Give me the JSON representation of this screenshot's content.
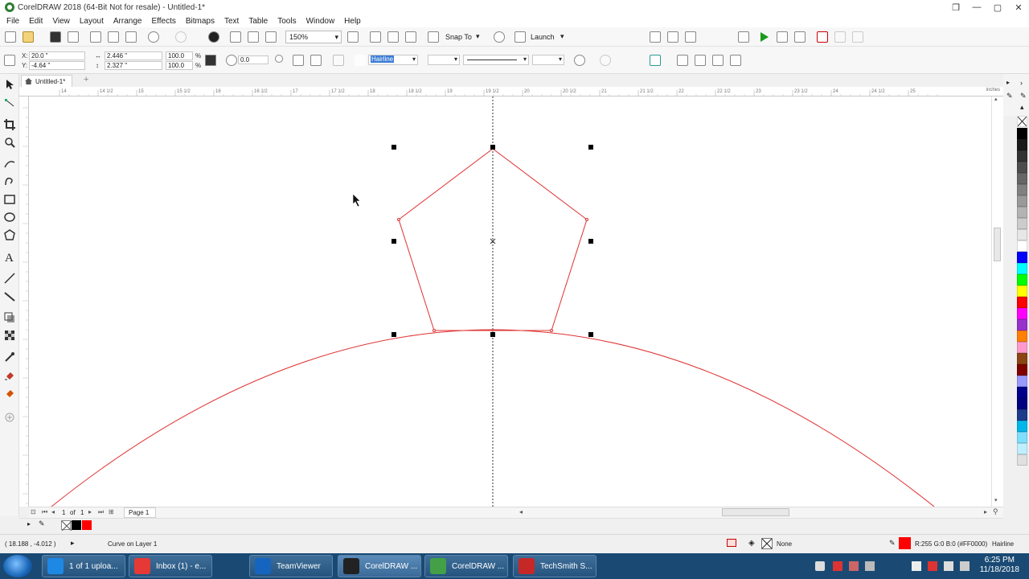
{
  "window": {
    "title": "CorelDRAW 2018 (64-Bit Not for resale) - Untitled-1*",
    "buttons": [
      "restore-down",
      "minimize",
      "maximize",
      "close"
    ]
  },
  "menu": [
    "File",
    "Edit",
    "View",
    "Layout",
    "Arrange",
    "Effects",
    "Bitmaps",
    "Text",
    "Table",
    "Tools",
    "Window",
    "Help"
  ],
  "toolbar": {
    "zoom_level": "150%",
    "snap_label": "Snap To",
    "launch_label": "Launch"
  },
  "property_bar": {
    "x": "20.0 \"",
    "y": "-4.64 \"",
    "width": "2.446 \"",
    "height": "2.327 \"",
    "scale_w": "100.0",
    "scale_h": "100.0",
    "percent": "%",
    "rotation": "0.0",
    "outline_width": "Hairline"
  },
  "document": {
    "tab": "Untitled-1*"
  },
  "rulers": {
    "h_labels": [
      "14",
      "14 1/2",
      "15",
      "15 1/2",
      "16",
      "16 1/2",
      "17",
      "17 1/2",
      "18",
      "18 1/2",
      "19",
      "19 1/2",
      "20",
      "20 1/2",
      "21",
      "21 1/2",
      "22",
      "22 1/2",
      "23",
      "23 1/2",
      "24",
      "24 1/2",
      "25"
    ],
    "units": "inches"
  },
  "page_nav": {
    "current": "1",
    "of": "of",
    "total": "1",
    "tab": "Page 1"
  },
  "palette": [
    "#ffffff",
    "#000000",
    "#1a1a1a",
    "#333333",
    "#4d4d4d",
    "#666666",
    "#808080",
    "#999999",
    "#b3b3b3",
    "#cccccc",
    "#e6e6e6",
    "#ffffff",
    "#0000ff",
    "#00ffff",
    "#00ff00",
    "#ffff00",
    "#ff0000",
    "#ff00ff",
    "#9932cc",
    "#ff7f00",
    "#ff99cc",
    "#8b4513",
    "#800000",
    "#9999ff",
    "#00008b",
    "#000080",
    "#1e3a8a",
    "#00b7eb",
    "#7fdfff",
    "#bfefff",
    "#e0e0e0"
  ],
  "status": {
    "coords": "( 18.188 , -4.012 )",
    "object": "Curve on Layer 1",
    "fill": "None",
    "outline_info": "R:255 G:0 B:0 (#FF0000)",
    "outline_width": "Hairline",
    "outline_color": "#ff0000"
  },
  "taskbar": {
    "items": [
      {
        "label": "1 of 1 uploa...",
        "color": "#1e88e5"
      },
      {
        "label": "Inbox (1) - e...",
        "color": "#e53935"
      },
      {
        "label": "TeamViewer",
        "color": "#1565c0"
      },
      {
        "label": "CorelDRAW ...",
        "color": "#222222"
      },
      {
        "label": "CorelDRAW ...",
        "color": "#43a047"
      },
      {
        "label": "TechSmith S...",
        "color": "#c62828"
      }
    ],
    "time": "6:25 PM",
    "date": "11/18/2018"
  }
}
